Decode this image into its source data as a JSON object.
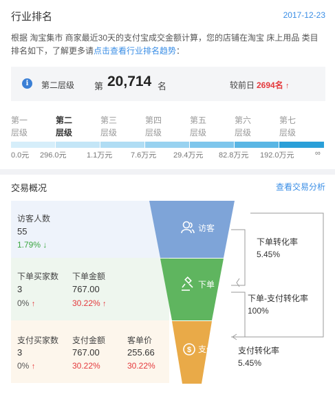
{
  "header": {
    "title": "行业排名",
    "date": "2017-12-23",
    "description": "根据 淘宝集市 商家最近30天的支付宝成交金额计算，您的店铺在淘宝 床上用品 类目排名如下，了解更多请",
    "description_link": "点击查看行业排名趋势",
    "description_end": "："
  },
  "rank": {
    "tier_label": "第二层级",
    "prefix": "第",
    "number": "20,714",
    "suffix": "名",
    "compare_label": "较前日",
    "compare_value": "2694名",
    "compare_arrow": "↑"
  },
  "tiers": [
    {
      "line1": "第一",
      "line2": "层级",
      "active": false
    },
    {
      "line1": "第二",
      "line2": "层级",
      "active": true
    },
    {
      "line1": "第三",
      "line2": "层级",
      "active": false
    },
    {
      "line1": "第四",
      "line2": "层级",
      "active": false
    },
    {
      "line1": "第五",
      "line2": "层级",
      "active": false
    },
    {
      "line1": "第六",
      "line2": "层级",
      "active": false
    },
    {
      "line1": "第七",
      "line2": "层级",
      "active": false
    }
  ],
  "tier_bar_colors": [
    "#d6eefa",
    "#c4e6f7",
    "#b0ddf4",
    "#98d2f0",
    "#7ec6ec",
    "#5ab6e4",
    "#2a9fd8"
  ],
  "tier_ticks": [
    "0.0元",
    "296.0元",
    "1.1万元",
    "7.6万元",
    "29.4万元",
    "82.8万元",
    "192.0万元",
    "∞"
  ],
  "trade": {
    "title": "交易概况",
    "link": "查看交易分析",
    "visitors": {
      "label": "访客人数",
      "value": "55",
      "pct": "1.79%",
      "arrow": "↓"
    },
    "order": {
      "buyers": {
        "label": "下单买家数",
        "value": "3",
        "pct": "0%",
        "arrow": "↑"
      },
      "amount": {
        "label": "下单金额",
        "value": "767.00",
        "pct": "30.22%",
        "arrow": "↑"
      }
    },
    "pay": {
      "buyers": {
        "label": "支付买家数",
        "value": "3",
        "pct": "0%",
        "arrow": "↑"
      },
      "amount": {
        "label": "支付金额",
        "value": "767.00",
        "pct": "30.22%"
      },
      "unit_price": {
        "label": "客单价",
        "value": "255.66",
        "pct": "30.22%"
      }
    }
  },
  "funnel": {
    "stages": [
      {
        "label": "访客",
        "icon": "person-icon",
        "color": "#7ea4d8"
      },
      {
        "label": "下单",
        "icon": "gavel-icon",
        "color": "#5fb55f"
      },
      {
        "label": "支付",
        "icon": "coin-icon",
        "color": "#e9aa48"
      }
    ]
  },
  "conversions": [
    {
      "label": "下单转化率",
      "value": "5.45%"
    },
    {
      "label": "下单-支付转化率",
      "value": "100%"
    },
    {
      "label": "支付转化率",
      "value": "5.45%"
    }
  ]
}
